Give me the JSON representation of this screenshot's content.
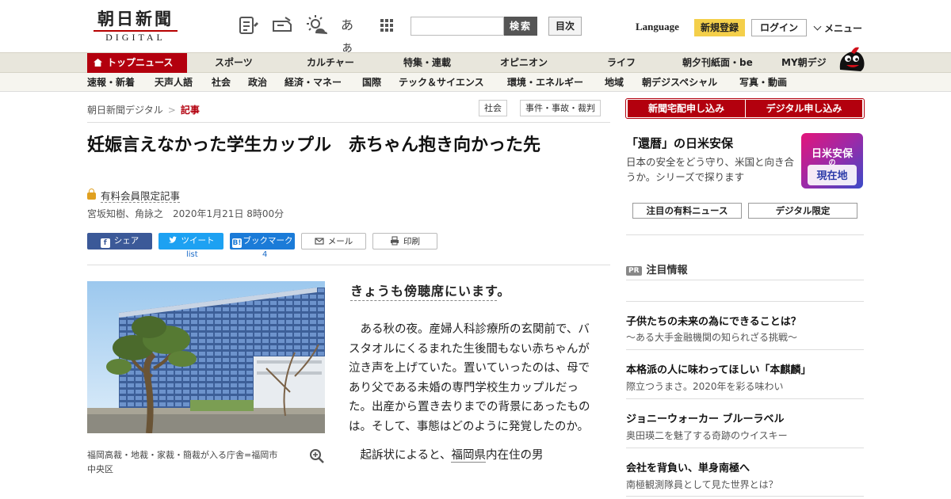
{
  "header": {
    "logo_ja": "朝日新聞",
    "logo_en": "DIGITAL",
    "font_size_label": "あぁ",
    "search_button": "検索",
    "toc_button": "目次",
    "language": "Language",
    "register": "新規登録",
    "login": "ログイン",
    "menu": "メニュー"
  },
  "nav_primary": [
    "トップニュース",
    "スポーツ",
    "カルチャー",
    "特集・連載",
    "オピニオン",
    "ライフ",
    "朝夕刊紙面・be",
    "MY朝デジ"
  ],
  "nav_secondary": [
    "速報・新着",
    "天声人語",
    "社会",
    "政治",
    "経済・マネー",
    "国際",
    "テック＆サイエンス",
    "環境・エネルギー",
    "地域",
    "朝デジスペシャル",
    "写真・動画"
  ],
  "breadcrumb": {
    "home": "朝日新聞デジタル",
    "current": "記事",
    "separator": ">"
  },
  "tags": [
    "社会",
    "事件・事故・裁判"
  ],
  "article": {
    "headline": "妊娠言えなかった学生カップル　赤ちゃん抱き向かった先",
    "paid_label": "有料会員限定記事",
    "byline": "宮坂知樹、角詠之　2020年1月21日 8時00分",
    "photo_caption": "福岡高裁・地裁・家裁・簡裁が入る庁舎=福岡市中央区",
    "lead": "きょうも傍聴席にいます",
    "lead_period": "。",
    "paragraph1": "ある秋の夜。産婦人科診療所の玄関前で、バスタオルにくるまれた生後間もない赤ちゃんが泣き声を上げていた。置いていったのは、母であり父である未婚の専門学校生カップルだった。出産から置き去りまでの背景にあったものは。そして、事態はどのように発覚したのか。",
    "paragraph2_pre": "起訴状によると、",
    "paragraph2_link": "福岡県",
    "paragraph2_post": "内在住の男"
  },
  "share": {
    "facebook": "シェア",
    "twitter": "ツイート",
    "hatena": "ブックマーク",
    "mail": "メール",
    "print": "印刷",
    "twitter_count": "list",
    "hatena_count": "4"
  },
  "sidebar": {
    "subscribe_paper": "新聞宅配申し込み",
    "subscribe_digital": "デジタル申し込み",
    "feature_title": "「還暦」の日米安保",
    "feature_desc": "日本の安全をどう守り、米国と向き合うか。シリーズで探ります",
    "feature_img_line1": "日米安保",
    "feature_img_line2": "の",
    "feature_img_line3": "現在地",
    "btn_paid_news": "注目の有料ニュース",
    "btn_digital_only": "デジタル限定",
    "pr_badge": "PR",
    "pr_head": "注目情報",
    "ads": [
      {
        "title": "子供たちの未来の為にできることは？",
        "sub": "～ある大手金融機関の知られざる挑戦～"
      },
      {
        "title": "本格派の人に味わってほしい「本麒麟」",
        "sub": "際立つうまさ。2020年を彩る味わい"
      },
      {
        "title": "ジョニーウォーカー ブルーラベル",
        "sub": "奥田瑛二を魅了する奇跡のウイスキー"
      },
      {
        "title": "会社を背負い、単身南極へ",
        "sub": "南極観測隊員として見た世界とは？"
      }
    ]
  },
  "colors": {
    "brand_red": "#b3000e",
    "register_yellow": "#f4cf4a",
    "facebook": "#3b5998",
    "twitter": "#1da1f2",
    "hatena": "#1b7bd8"
  },
  "icons": [
    "article-list-icon",
    "ticket-icon",
    "weather-icon",
    "font-size-icon",
    "grid-menu-icon",
    "home-icon",
    "lock-icon",
    "zoom-icon",
    "mascot-icon"
  ]
}
